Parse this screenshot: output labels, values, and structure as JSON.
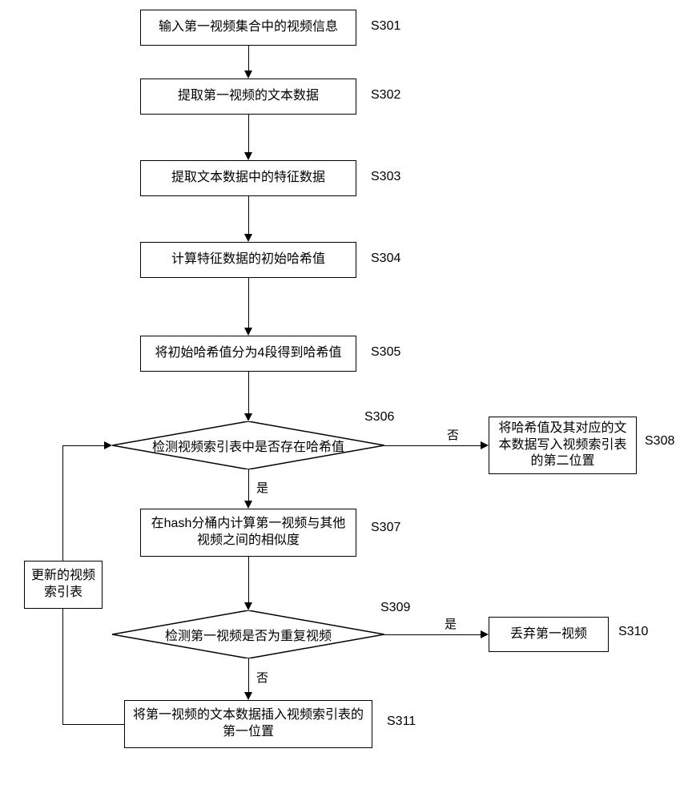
{
  "chart_data": {
    "type": "flowchart",
    "nodes": [
      {
        "id": "S301",
        "kind": "process",
        "text": "输入第一视频集合中的视频信息"
      },
      {
        "id": "S302",
        "kind": "process",
        "text": "提取第一视频的文本数据"
      },
      {
        "id": "S303",
        "kind": "process",
        "text": "提取文本数据中的特征数据"
      },
      {
        "id": "S304",
        "kind": "process",
        "text": "计算特征数据的初始哈希值"
      },
      {
        "id": "S305",
        "kind": "process",
        "text": "将初始哈希值分为4段得到哈希值"
      },
      {
        "id": "S306",
        "kind": "decision",
        "text": "检测视频索引表中是否存在哈希值"
      },
      {
        "id": "S307",
        "kind": "process",
        "text": "在hash分桶内计算第一视频与其他视频之间的相似度"
      },
      {
        "id": "S308",
        "kind": "process",
        "text": "将哈希值及其对应的文本数据写入视频索引表的第二位置"
      },
      {
        "id": "S309",
        "kind": "decision",
        "text": "检测第一视频是否为重复视频"
      },
      {
        "id": "S310",
        "kind": "process",
        "text": "丢弃第一视频"
      },
      {
        "id": "S311",
        "kind": "process",
        "text": "将第一视频的文本数据插入视频索引表的第一位置"
      },
      {
        "id": "SIDE",
        "kind": "process",
        "text": "更新的视频索引表"
      }
    ],
    "edges": [
      {
        "from": "S301",
        "to": "S302"
      },
      {
        "from": "S302",
        "to": "S303"
      },
      {
        "from": "S303",
        "to": "S304"
      },
      {
        "from": "S304",
        "to": "S305"
      },
      {
        "from": "S305",
        "to": "S306"
      },
      {
        "from": "S306",
        "to": "S307",
        "label": "是"
      },
      {
        "from": "S306",
        "to": "S308",
        "label": "否"
      },
      {
        "from": "S307",
        "to": "S309"
      },
      {
        "from": "S309",
        "to": "S310",
        "label": "是"
      },
      {
        "from": "S309",
        "to": "S311",
        "label": "否"
      },
      {
        "from": "S311",
        "to": "S306",
        "via": "SIDE",
        "note": "更新的视频索引表"
      }
    ]
  },
  "labels": {
    "S301": "S301",
    "S302": "S302",
    "S303": "S303",
    "S304": "S304",
    "S305": "S305",
    "S306": "S306",
    "S307": "S307",
    "S308": "S308",
    "S309": "S309",
    "S310": "S310",
    "S311": "S311",
    "yes": "是",
    "no": "否"
  }
}
